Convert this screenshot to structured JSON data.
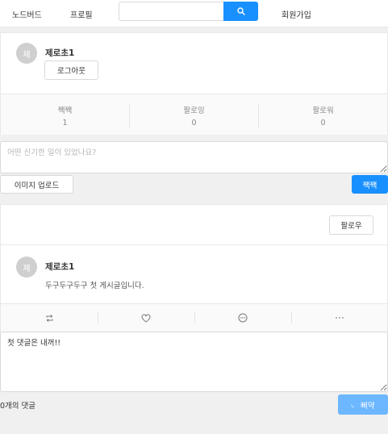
{
  "nav": {
    "home_label": "노드버드",
    "profile_label": "프로필",
    "search_value": "",
    "search_placeholder": "",
    "signup_label": "회원가입"
  },
  "user_card": {
    "avatar_initial": "제",
    "nickname": "제로초1",
    "logout_label": "로그아웃",
    "stats": [
      {
        "label": "짹짹",
        "value": "1"
      },
      {
        "label": "팔로잉",
        "value": "0"
      },
      {
        "label": "팔로워",
        "value": "0"
      }
    ]
  },
  "post_form": {
    "placeholder": "어떤 신기한 일이 있었나요?",
    "upload_label": "이미지 업로드",
    "submit_label": "짹짹"
  },
  "post": {
    "follow_label": "팔로우",
    "avatar_initial": "제",
    "author": "제로초1",
    "content": "두구두구두구 첫 게시글입니다."
  },
  "comment_form": {
    "value": "첫 댓글은 내꺼!!",
    "count_label": "0개의 댓글",
    "submit_label": "삐약"
  },
  "colors": {
    "primary": "#1890ff",
    "primary_faded": "#6cb7ff"
  }
}
